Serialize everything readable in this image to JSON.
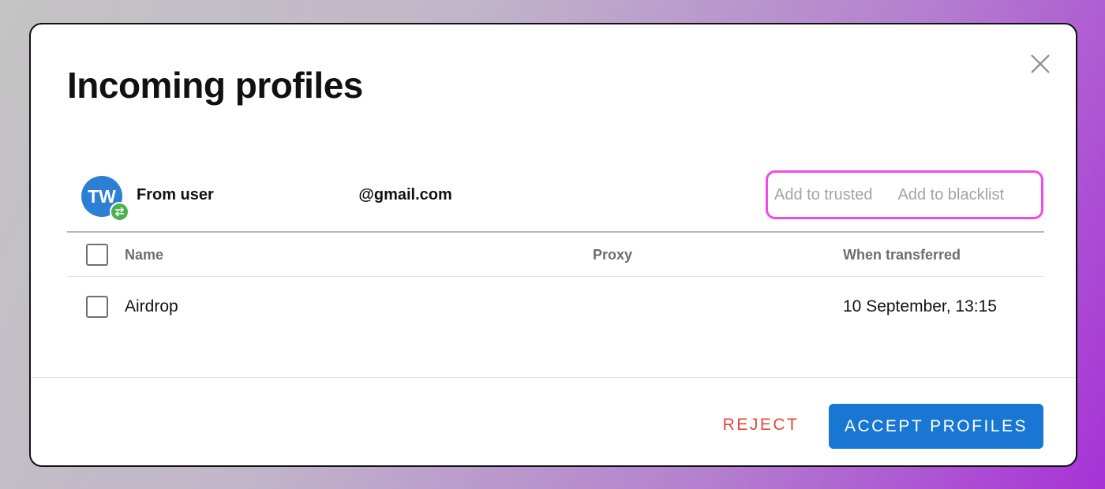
{
  "dialog": {
    "title": "Incoming profiles",
    "close_icon": "close-icon"
  },
  "sender": {
    "avatar_initials": "TW",
    "avatar_color": "#2d7fd3",
    "badge_icon": "transfer-arrows-icon",
    "badge_color": "#4caf50",
    "from_prefix": "From user ",
    "email_suffix": "@gmail.com"
  },
  "actions": {
    "add_trusted": "Add to trusted",
    "add_blacklist": "Add to blacklist",
    "highlight_color": "#ef4ae9"
  },
  "table": {
    "columns": [
      "Name",
      "Proxy",
      "When transferred"
    ],
    "rows": [
      {
        "name": "Airdrop",
        "proxy": "",
        "when": "10 September, 13:15",
        "checked": false
      }
    ]
  },
  "footer": {
    "reject_label": "REJECT",
    "accept_label": "ACCEPT PROFILES",
    "reject_color": "#e8453c",
    "accept_color": "#1976d2"
  }
}
